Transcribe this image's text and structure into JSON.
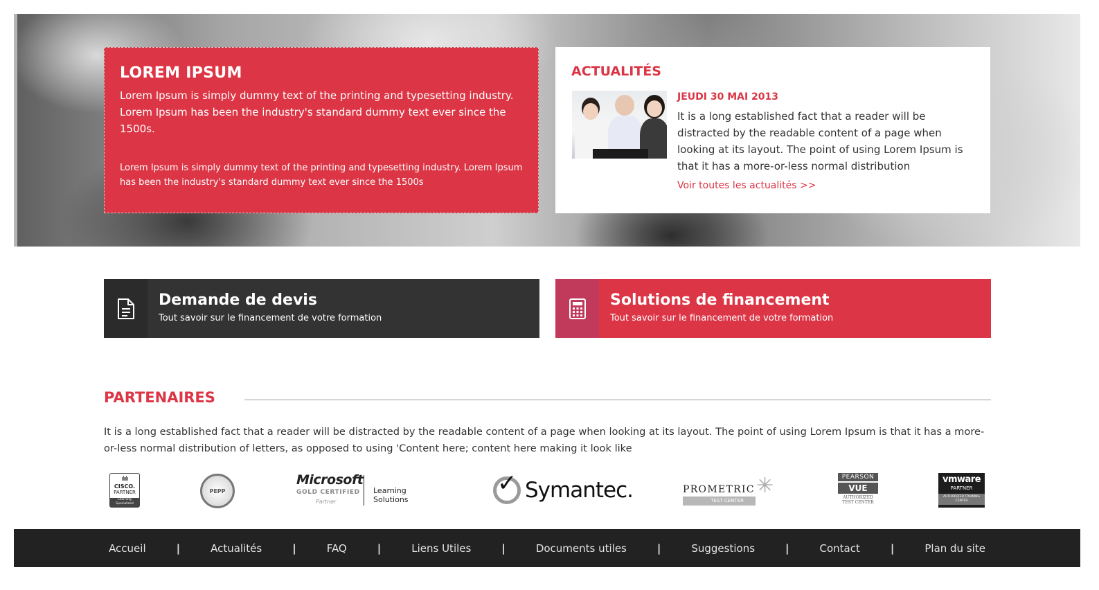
{
  "hero": {
    "box_title": "LOREM IPSUM",
    "box_lead": "Lorem Ipsum is simply dummy text of the printing and typesetting industry. Lorem Ipsum has been the industry's standard dummy text ever since the 1500s.",
    "box_small": "Lorem Ipsum is simply dummy text of the printing and typesetting industry. Lorem Ipsum has been the industry's standard dummy text ever since the 1500s"
  },
  "news": {
    "title": "ACTUALITÉS",
    "date": "JEUDI 30 MAI 2013",
    "text": "It is a long established fact that a reader will be distracted by the readable content of a page when looking at its layout. The point of using Lorem Ipsum is that it has a more-or-less normal distribution",
    "link": "Voir toutes les actualités >>"
  },
  "cta": {
    "quote_title": "Demande de devis",
    "quote_sub": "Tout savoir sur le financement de votre formation",
    "finance_title": "Solutions de financement",
    "finance_sub": "Tout savoir sur le financement de votre formation"
  },
  "partners": {
    "title": "PARTENAIRES",
    "text": "It is a long established fact that a reader will be distracted by the readable content of a page when looking at its layout. The point of using Lorem Ipsum is that it has a more-or-less normal distribution of letters, as opposed to using 'Content here; content here making it look like",
    "logos": {
      "cisco_name": "CISCO.",
      "cisco_partner": "PARTNER",
      "cisco_band": "Learning Specialized",
      "pepp": "PEPP",
      "ms_brand": "Microsoft",
      "ms_gold": "GOLD CERTIFIED",
      "ms_partner": "Partner",
      "ms_learning": "Learning Solutions",
      "symantec": "Symantec.",
      "prometric": "PROMETRIC",
      "prometric_band": "TEST CENTER",
      "pearson": "PEARSON",
      "pearson_vue": "VUE",
      "pearson_atc": "AUTHORIZED TEST CENTER",
      "vmware": "vmware",
      "vmware_partner": "PARTNER",
      "vmware_band": "AUTHORIZED TRAINING CENTER"
    }
  },
  "footer": {
    "links": [
      "Accueil",
      "Actualités",
      "FAQ",
      "Liens Utiles",
      "Documents utiles",
      "Suggestions",
      "Contact",
      "Plan du site"
    ],
    "separator": "|"
  },
  "colors": {
    "accent": "#dc3545",
    "dark": "#333333",
    "footer_bg": "#222222"
  }
}
